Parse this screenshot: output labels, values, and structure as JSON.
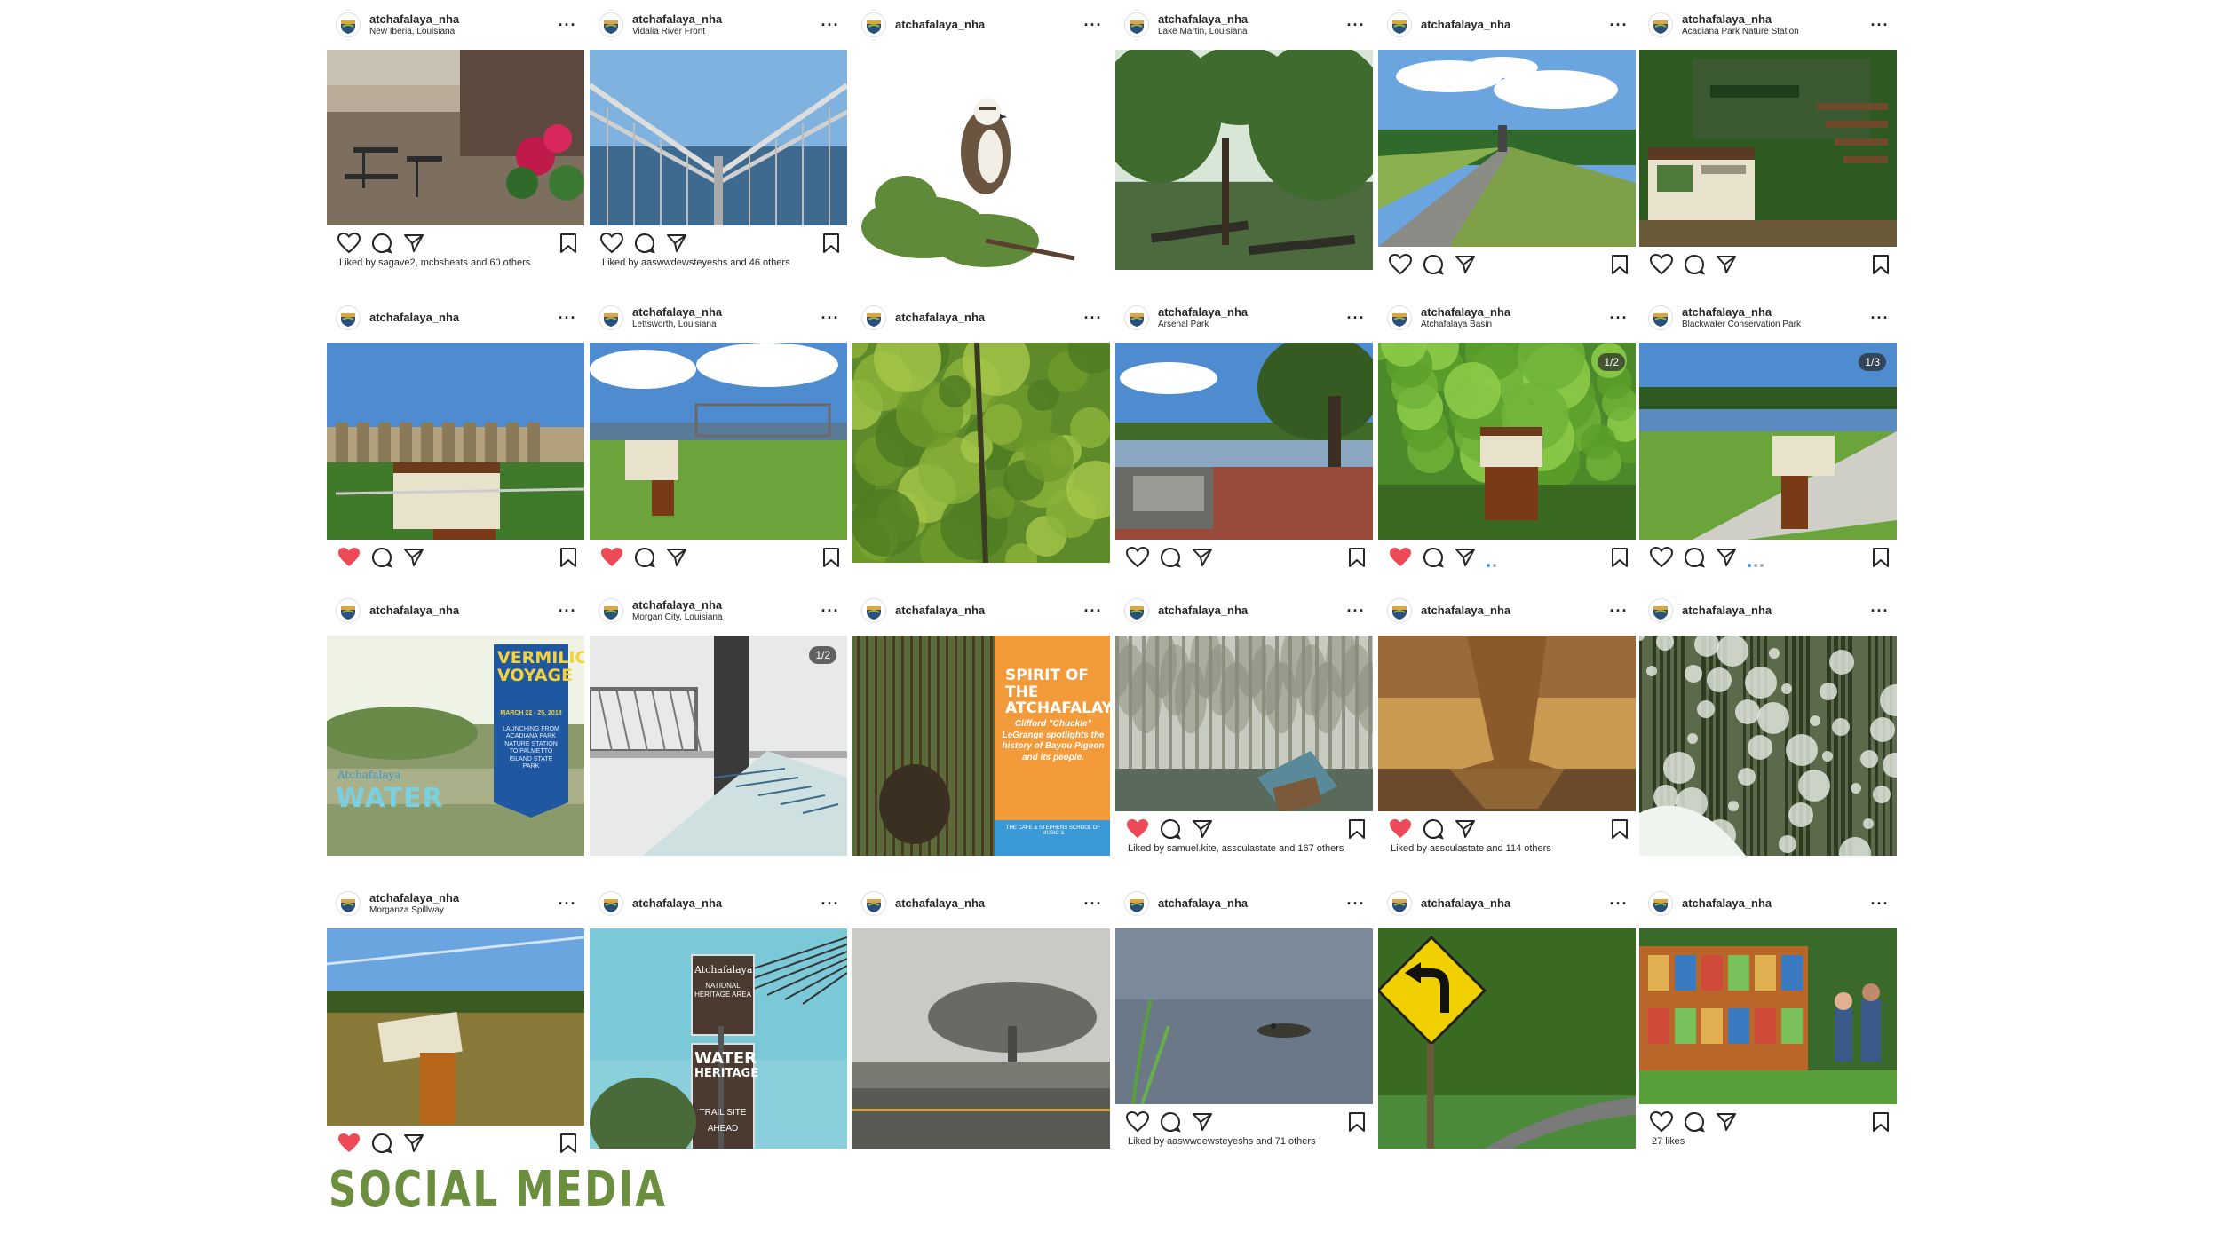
{
  "page_title": "SOCIAL MEDIA",
  "colors": {
    "accent": "#6b8e3f",
    "like_red": "#ed4956",
    "ig_blue": "#3897f0"
  },
  "posts": [
    {
      "username": "atchafalaya_nha",
      "location": "New Iberia, Louisiana",
      "liked": false,
      "liked_by": "Liked by sagave2, mcbsheats and 60 others"
    },
    {
      "username": "atchafalaya_nha",
      "location": "Vidalia River Front",
      "liked": false,
      "liked_by": "Liked by aaswwdewsteyeshs and 46 others"
    },
    {
      "username": "atchafalaya_nha",
      "location": "",
      "liked": false,
      "liked_by": ""
    },
    {
      "username": "atchafalaya_nha",
      "location": "Lake Martin, Louisiana",
      "liked": false,
      "liked_by": ""
    },
    {
      "username": "atchafalaya_nha",
      "location": "",
      "liked": false,
      "liked_by": ""
    },
    {
      "username": "atchafalaya_nha",
      "location": "Acadiana Park Nature Station",
      "liked": false,
      "liked_by": ""
    },
    {
      "username": "atchafalaya_nha",
      "location": "",
      "liked": true,
      "liked_by": ""
    },
    {
      "username": "atchafalaya_nha",
      "location": "Lettsworth, Louisiana",
      "liked": true,
      "liked_by": ""
    },
    {
      "username": "atchafalaya_nha",
      "location": "",
      "liked": false,
      "liked_by": ""
    },
    {
      "username": "atchafalaya_nha",
      "location": "Arsenal Park",
      "liked": false,
      "liked_by": ""
    },
    {
      "username": "atchafalaya_nha",
      "location": "Atchafalaya Basin",
      "liked": true,
      "liked_by": "",
      "counter": "1/2"
    },
    {
      "username": "atchafalaya_nha",
      "location": "Blackwater Conservation Park",
      "liked": false,
      "liked_by": "",
      "counter": "1/3"
    },
    {
      "username": "atchafalaya_nha",
      "location": "",
      "liked": false,
      "liked_by": ""
    },
    {
      "username": "atchafalaya_nha",
      "location": "Morgan City, Louisiana",
      "liked": false,
      "liked_by": "",
      "counter": "1/2"
    },
    {
      "username": "atchafalaya_nha",
      "location": "",
      "liked": false,
      "liked_by": ""
    },
    {
      "username": "atchafalaya_nha",
      "location": "",
      "liked": true,
      "liked_by": "Liked by samuel.kite, assculastate and 167 others"
    },
    {
      "username": "atchafalaya_nha",
      "location": "",
      "liked": true,
      "liked_by": "Liked by assculastate and 114 others"
    },
    {
      "username": "atchafalaya_nha",
      "location": "",
      "liked": false,
      "liked_by": ""
    },
    {
      "username": "atchafalaya_nha",
      "location": "Morganza Spillway",
      "liked": true,
      "liked_by": ""
    },
    {
      "username": "atchafalaya_nha",
      "location": "",
      "liked": false,
      "liked_by": ""
    },
    {
      "username": "atchafalaya_nha",
      "location": "",
      "liked": false,
      "liked_by": ""
    },
    {
      "username": "atchafalaya_nha",
      "location": "",
      "liked": false,
      "liked_by": "Liked by aaswwdewsteyeshs and 71 others"
    },
    {
      "username": "atchafalaya_nha",
      "location": "",
      "liked": false,
      "liked_by": ""
    },
    {
      "username": "atchafalaya_nha",
      "location": "",
      "liked": false,
      "liked_by": "27 likes"
    }
  ],
  "posters": {
    "vermilion_title": "VERMILION VOYAGE",
    "vermilion_date": "MARCH 22 - 25, 2018",
    "vermilion_sub": "LAUNCHING FROM ACADIANA PARK NATURE STATION TO PALMETTO ISLAND STATE PARK",
    "water_brand": "Atchafalaya",
    "water_word": "WATER",
    "spirit_title": "SPIRIT OF THE ATCHAFALAYA",
    "spirit_body": "Clifford \"Chuckie\" LeGrange spotlights the history of Bayou Pigeon and its people.",
    "spirit_footer": "THE CAFE & STEPHENS SCHOOL OF MUSIC &",
    "sign_top": "Atchafalaya",
    "sign_mid": "NATIONAL HERITAGE AREA",
    "sign_water": "WATER",
    "sign_heritage": "HERITAGE",
    "sign_trail": "TRAIL SITE",
    "sign_ahead": "AHEAD"
  }
}
